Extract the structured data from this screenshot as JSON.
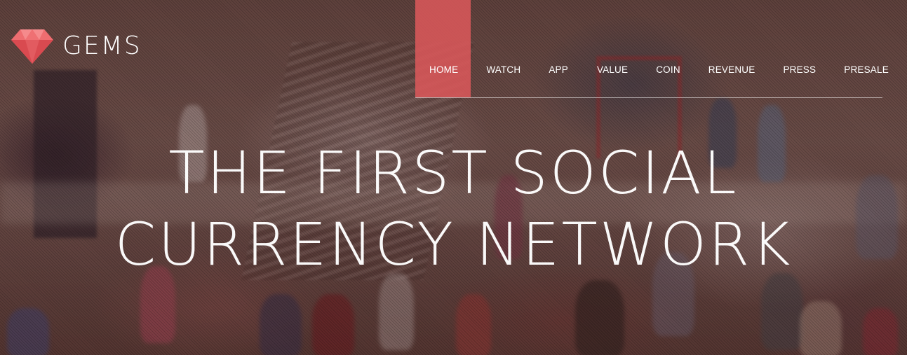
{
  "brand": {
    "name": "GEMS",
    "logo_icon": "gem-icon",
    "logo_color": "#e8595d"
  },
  "nav": {
    "items": [
      {
        "label": "HOME",
        "active": true
      },
      {
        "label": "WATCH"
      },
      {
        "label": "APP"
      },
      {
        "label": "VALUE"
      },
      {
        "label": "COIN"
      },
      {
        "label": "REVENUE"
      },
      {
        "label": "PRESS"
      },
      {
        "label": "PRESALE"
      }
    ],
    "active_color": "#d9585a"
  },
  "hero": {
    "headline_line1": "THE FIRST SOCIAL",
    "headline_line2": "CURRENCY NETWORK"
  }
}
